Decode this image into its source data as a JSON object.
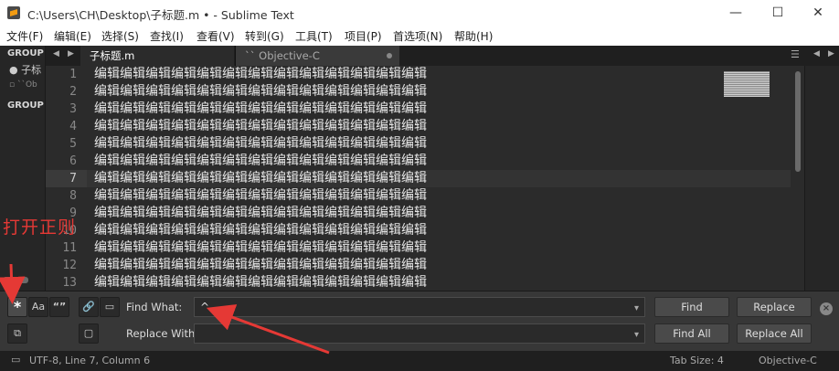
{
  "window": {
    "title": "C:\\Users\\CH\\Desktop\\子标题.m • - Sublime Text"
  },
  "menu": [
    "文件(F)",
    "编辑(E)",
    "选择(S)",
    "查找(I)",
    "查看(V)",
    "转到(G)",
    "工具(T)",
    "项目(P)",
    "首选项(N)",
    "帮助(H)"
  ],
  "sidebar": {
    "group1": "GROUP",
    "file1": "● 子标",
    "file2": "▫ ``Ob",
    "group2": "GROUP"
  },
  "tabs": [
    {
      "label": "子标题.m",
      "active": true
    },
    {
      "label": "`` Objective-C",
      "active": false
    }
  ],
  "editor": {
    "line_numbers": [
      "1",
      "2",
      "3",
      "4",
      "5",
      "6",
      "7",
      "8",
      "9",
      "10",
      "11",
      "12",
      "13"
    ],
    "lines": [
      "编辑编辑编辑编辑编辑编辑编辑编辑编辑编辑编辑编辑编辑",
      "编辑编辑编辑编辑编辑编辑编辑编辑编辑编辑编辑编辑编辑",
      "编辑编辑编辑编辑编辑编辑编辑编辑编辑编辑编辑编辑编辑",
      "编辑编辑编辑编辑编辑编辑编辑编辑编辑编辑编辑编辑编辑",
      "编辑编辑编辑编辑编辑编辑编辑编辑编辑编辑编辑编辑编辑",
      "编辑编辑编辑编辑编辑编辑编辑编辑编辑编辑编辑编辑编辑",
      "编辑编辑编辑编辑编辑编辑编辑编辑编辑编辑编辑编辑编辑",
      "编辑编辑编辑编辑编辑编辑编辑编辑编辑编辑编辑编辑编辑",
      "编辑编辑编辑编辑编辑编辑编辑编辑编辑编辑编辑编辑编辑",
      "编辑编辑编辑编辑编辑编辑编辑编辑编辑编辑编辑编辑编辑",
      "编辑编辑编辑编辑编辑编辑编辑编辑编辑编辑编辑编辑编辑",
      "编辑编辑编辑编辑编辑编辑编辑编辑编辑编辑编辑编辑编辑",
      "编辑编辑编辑编辑编辑编辑编辑编辑编辑编辑编辑编辑编辑"
    ],
    "current_line_index": 6
  },
  "find_panel": {
    "find_label": "Find What:",
    "find_value": "^",
    "replace_label": "Replace With:",
    "replace_value": "",
    "buttons": {
      "find": "Find",
      "replace": "Replace",
      "find_all": "Find All",
      "replace_all": "Replace All"
    },
    "options": {
      "regex": "*",
      "case": "Aa",
      "word": "“”",
      "wrap": "⊘",
      "in_selection": "▭",
      "highlight": "▢"
    }
  },
  "status": {
    "left": "UTF-8, Line 7, Column 6",
    "tab_size": "Tab Size: 4",
    "syntax": "Objective-C"
  },
  "annotation": {
    "label": "打开正则",
    "color": "#e53935"
  }
}
